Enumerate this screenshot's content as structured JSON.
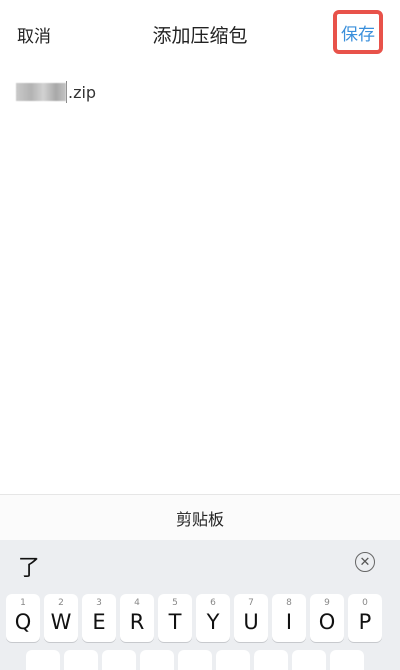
{
  "header": {
    "cancel_label": "取消",
    "title": "添加压缩包",
    "save_label": "保存"
  },
  "filename": {
    "extension": ".zip"
  },
  "clipboard": {
    "label": "剪贴板"
  },
  "keyboard": {
    "candidate": "了",
    "clear_symbol": "✕",
    "row1": [
      {
        "num": "1",
        "letter": "Q"
      },
      {
        "num": "2",
        "letter": "W"
      },
      {
        "num": "3",
        "letter": "E"
      },
      {
        "num": "4",
        "letter": "R"
      },
      {
        "num": "5",
        "letter": "T"
      },
      {
        "num": "6",
        "letter": "Y"
      },
      {
        "num": "7",
        "letter": "U"
      },
      {
        "num": "8",
        "letter": "I"
      },
      {
        "num": "9",
        "letter": "O"
      },
      {
        "num": "0",
        "letter": "P"
      }
    ]
  },
  "colors": {
    "accent": "#3a8fdb",
    "highlight_border": "#e8524a"
  }
}
